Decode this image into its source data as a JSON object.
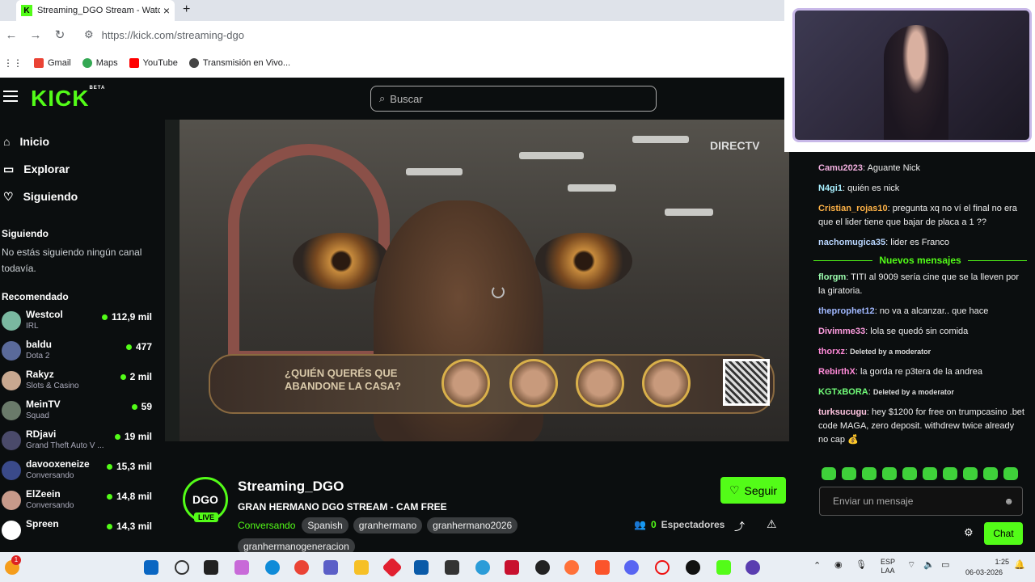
{
  "browser": {
    "tab_title": "Streaming_DGO Stream - Watch",
    "tab_close": "×",
    "new_tab": "+",
    "url": "https://kick.com/streaming-dgo",
    "nav_back": "←",
    "nav_forward": "→",
    "nav_reload": "↻",
    "bookmarks": [
      {
        "label": "Gmail",
        "color": "#ea4335"
      },
      {
        "label": "Maps",
        "color": "#34a853"
      },
      {
        "label": "YouTube",
        "color": "#ff0000"
      },
      {
        "label": "Transmisión en Vivo...",
        "color": "#444444"
      }
    ]
  },
  "kick": {
    "logo": "KICK",
    "logo_beta": "BETA",
    "search_placeholder": "Buscar",
    "brand_color": "#53fc18"
  },
  "sidebar": {
    "nav": [
      {
        "label": "Inicio",
        "icon": "home-icon"
      },
      {
        "label": "Explorar",
        "icon": "explore-icon"
      },
      {
        "label": "Siguiendo",
        "icon": "heart-icon"
      }
    ],
    "following_title": "Siguiendo",
    "following_empty": "No estás siguiendo ningún canal todavía.",
    "recommended_title": "Recomendado",
    "recommended": [
      {
        "name": "Westcol",
        "category": "IRL",
        "viewers": "112,9 mil",
        "avatar_color": "#7ab8a0"
      },
      {
        "name": "baldu",
        "category": "Dota 2",
        "viewers": "477",
        "avatar_color": "#5a6a9a"
      },
      {
        "name": "Rakyz",
        "category": "Slots & Casino",
        "viewers": "2 mil",
        "avatar_color": "#c8a890"
      },
      {
        "name": "MeinTV",
        "category": "Squad",
        "viewers": "59",
        "avatar_color": "#6a7a6a"
      },
      {
        "name": "RDjavi",
        "category": "Grand Theft Auto V ...",
        "viewers": "19 mil",
        "avatar_color": "#4a4a6a"
      },
      {
        "name": "davooxeneize",
        "category": "Conversando",
        "viewers": "15,3 mil",
        "avatar_color": "#3a4a8a"
      },
      {
        "name": "ElZeein",
        "category": "Conversando",
        "viewers": "14,8 mil",
        "avatar_color": "#c89a8a"
      },
      {
        "name": "Spreen",
        "category": "",
        "viewers": "14,3 mil",
        "avatar_color": "#ffffff"
      }
    ]
  },
  "player": {
    "overlay_text": "¿QUIÉN QUERÉS QUE ABANDONE LA CASA?",
    "broadcaster": "DIRECTV"
  },
  "channel": {
    "avatar_text": "DGO",
    "live_badge": "LIVE",
    "name": "Streaming_DGO",
    "title": "GRAN HERMANO DGO STREAM - CAM FREE",
    "category": "Conversando",
    "tags": [
      "Spanish",
      "granhermano",
      "granhermano2026",
      "granhermanogeneracion"
    ],
    "follow_label": "Seguir",
    "viewers_count": "0",
    "viewers_label": "Espectadores"
  },
  "chat": {
    "messages_before": [
      {
        "user": "Camu2023",
        "text": "Aguante Nick",
        "color": "#f3b0e0"
      },
      {
        "user": "N4gi1",
        "text": "quién es nick",
        "color": "#a9f0ff"
      },
      {
        "user": "Cristian_rojas10",
        "text": "pregunta xq no ví el final no era que el lider tiene que bajar de placa a 1 ??",
        "color": "#ffb347"
      },
      {
        "user": "nachomugica35",
        "text": "lider es Franco",
        "color": "#b9d6ff"
      }
    ],
    "new_messages_label": "Nuevos mensajes",
    "messages_after": [
      {
        "user": "florgm",
        "text": "TITI al 9009 sería cine que se la lleven por la giratoria.",
        "color": "#9dffb0",
        "deleted": false
      },
      {
        "user": "theprophet12",
        "text": "no va a alcanzar.. que hace",
        "color": "#a0b8ff",
        "deleted": false
      },
      {
        "user": "Divimme33",
        "text": "lola se quedó sin comida",
        "color": "#ff9de0",
        "deleted": false
      },
      {
        "user": "thorxz",
        "text": "Deleted by a moderator",
        "color": "#ff8ad8",
        "deleted": true
      },
      {
        "user": "RebirthX",
        "text": "la gorda re p3tera de la andrea",
        "color": "#ff8ad8",
        "deleted": false
      },
      {
        "user": "KGTxBORA",
        "text": "Deleted by a moderator",
        "color": "#72ff7a",
        "deleted": true
      },
      {
        "user": "turksucugu",
        "text": "hey $1200 for free on trumpcasino .bet code MAGA, zero deposit. withdrew twice already no cap 💰",
        "color": "#ffc4e0",
        "deleted": false
      }
    ],
    "input_placeholder": "Enviar un mensaje",
    "send_label": "Chat"
  },
  "taskbar": {
    "lang": "ESP",
    "lang2": "LAA",
    "time": "1:25",
    "date": "06-03-2026",
    "notification_count": "1"
  }
}
